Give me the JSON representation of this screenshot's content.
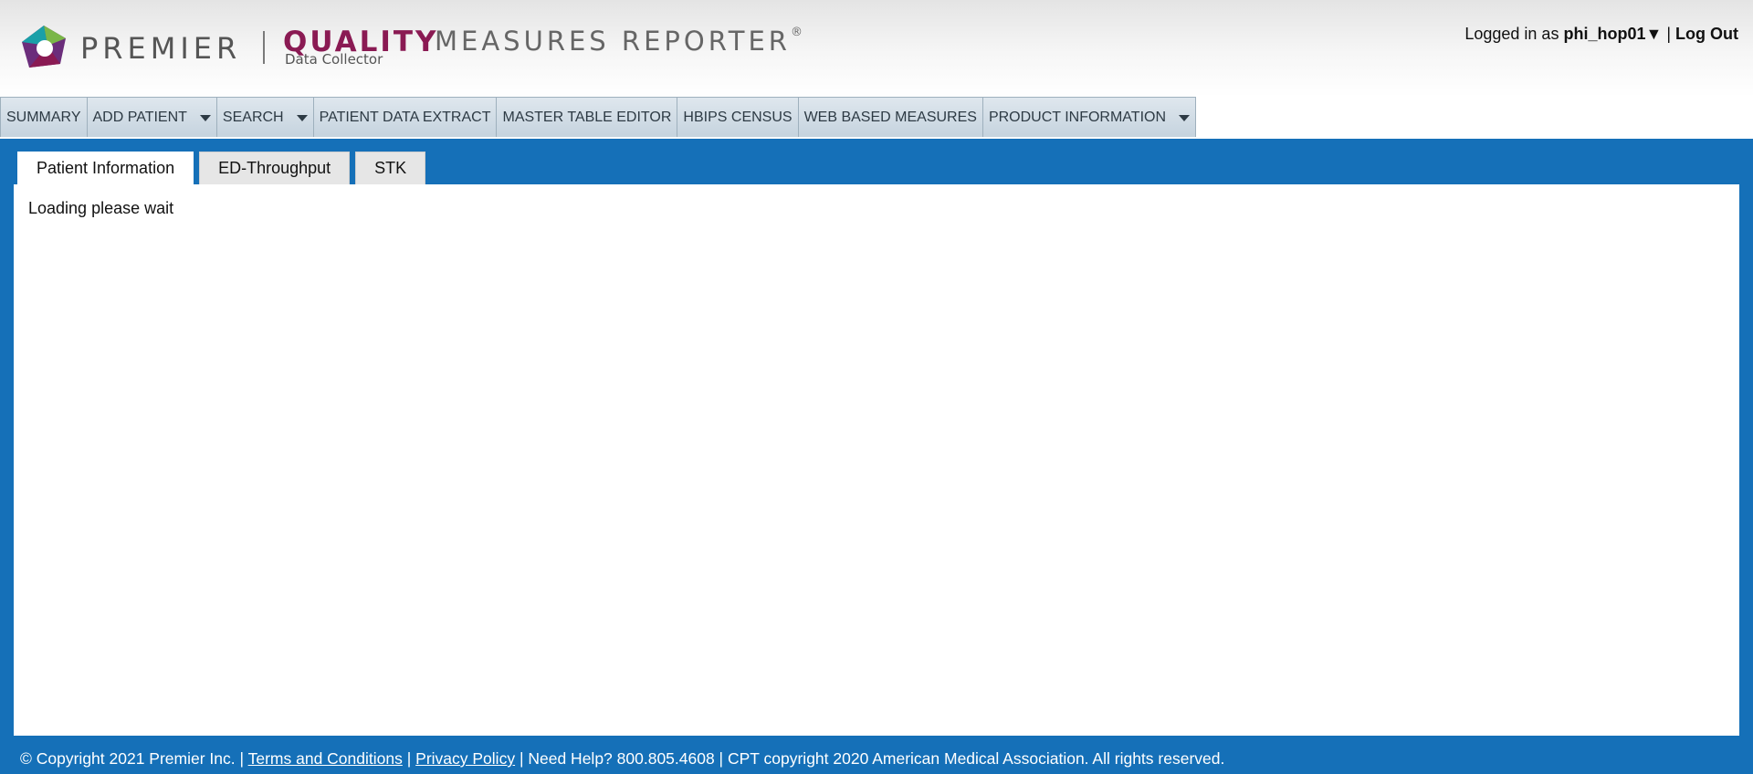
{
  "header": {
    "brand_premier": "PREMIER",
    "brand_quality": "QUALITY",
    "brand_measures_reporter": "MEASURES REPORTER",
    "brand_registered": "®",
    "brand_subtitle": "Data Collector",
    "logo_icon": "premier-logo-icon",
    "logged_in_prefix": "Logged in as",
    "username": "phi_hop01▼",
    "separator": "|",
    "logout_label": "Log Out"
  },
  "nav": {
    "items": [
      {
        "label": "SUMMARY",
        "dropdown": false
      },
      {
        "label": "ADD PATIENT",
        "dropdown": true
      },
      {
        "label": "SEARCH",
        "dropdown": true
      },
      {
        "label": "PATIENT DATA EXTRACT",
        "dropdown": false
      },
      {
        "label": "MASTER TABLE EDITOR",
        "dropdown": false
      },
      {
        "label": "HBIPS CENSUS",
        "dropdown": false
      },
      {
        "label": "WEB BASED MEASURES",
        "dropdown": false
      },
      {
        "label": "PRODUCT INFORMATION",
        "dropdown": true
      }
    ]
  },
  "tabs": [
    {
      "label": "Patient Information",
      "active": true
    },
    {
      "label": "ED-Throughput",
      "active": false
    },
    {
      "label": "STK",
      "active": false
    }
  ],
  "content": {
    "loading_text": "Loading please wait"
  },
  "footer": {
    "copyright": "© Copyright 2021 Premier Inc.",
    "sep1": "|",
    "terms_label": "Terms and Conditions",
    "sep2": "|",
    "privacy_label": "Privacy Policy",
    "help_text": "| Need Help? 800.805.4608 | CPT copyright 2020 American Medical Association. All rights reserved."
  },
  "colors": {
    "main_blue": "#1570b8",
    "brand_quality": "#8a1a53",
    "nav_text": "#2d3a44",
    "logo_green": "#7ab648",
    "logo_purple": "#6b2d7b",
    "logo_teal": "#1aa0a8"
  }
}
